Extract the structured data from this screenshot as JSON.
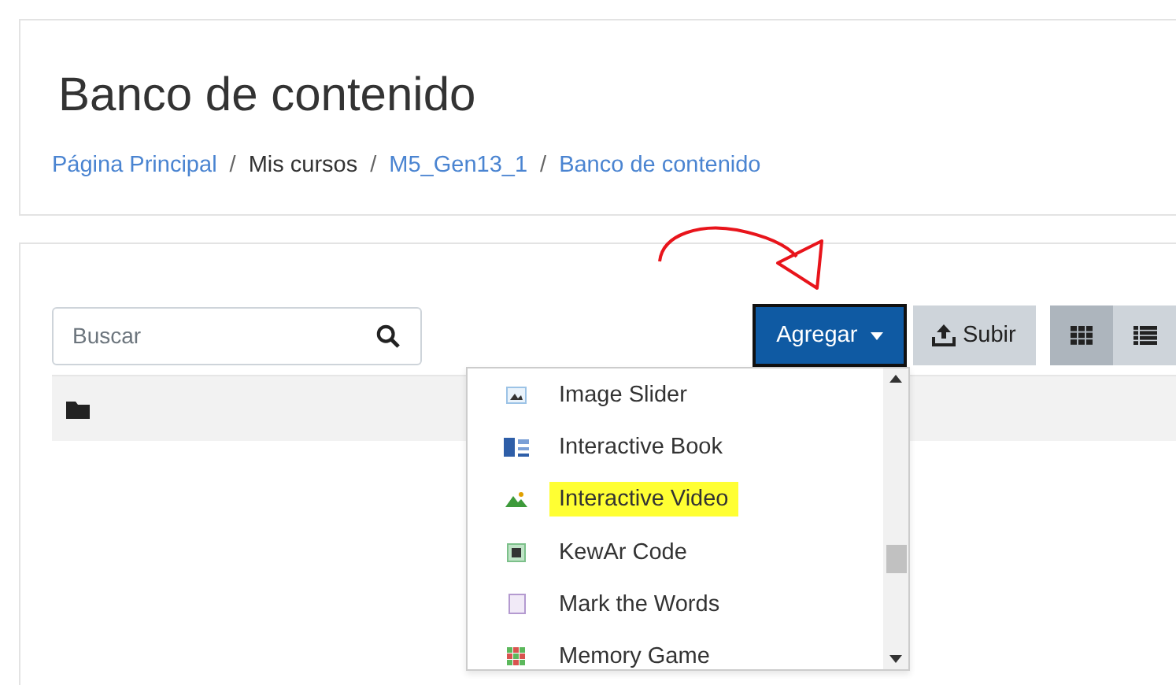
{
  "page": {
    "title": "Banco de contenido"
  },
  "breadcrumb_separator": "/",
  "breadcrumb": [
    {
      "label": "Página Principal",
      "kind": "link"
    },
    {
      "label": "Mis cursos",
      "kind": "text"
    },
    {
      "label": "M5_Gen13_1",
      "kind": "link"
    },
    {
      "label": "Banco de contenido",
      "kind": "link"
    }
  ],
  "search": {
    "placeholder": "Buscar"
  },
  "add_button": {
    "label": "Agregar",
    "expanded": true
  },
  "upload_button": {
    "label": "Subir"
  },
  "view_buttons": [
    {
      "kind": "grid",
      "selected": true
    },
    {
      "kind": "list",
      "selected": false
    }
  ],
  "add_menu": [
    {
      "label": "Image Slider",
      "kind": "image",
      "highlighted": false
    },
    {
      "label": "Interactive Book",
      "kind": "book",
      "highlighted": false
    },
    {
      "label": "Interactive Video",
      "kind": "video",
      "highlighted": true
    },
    {
      "label": "KewAr Code",
      "kind": "qr",
      "highlighted": false
    },
    {
      "label": "Mark the Words",
      "kind": "doc",
      "highlighted": false
    },
    {
      "label": "Memory Game",
      "kind": "grid",
      "highlighted": false
    }
  ]
}
